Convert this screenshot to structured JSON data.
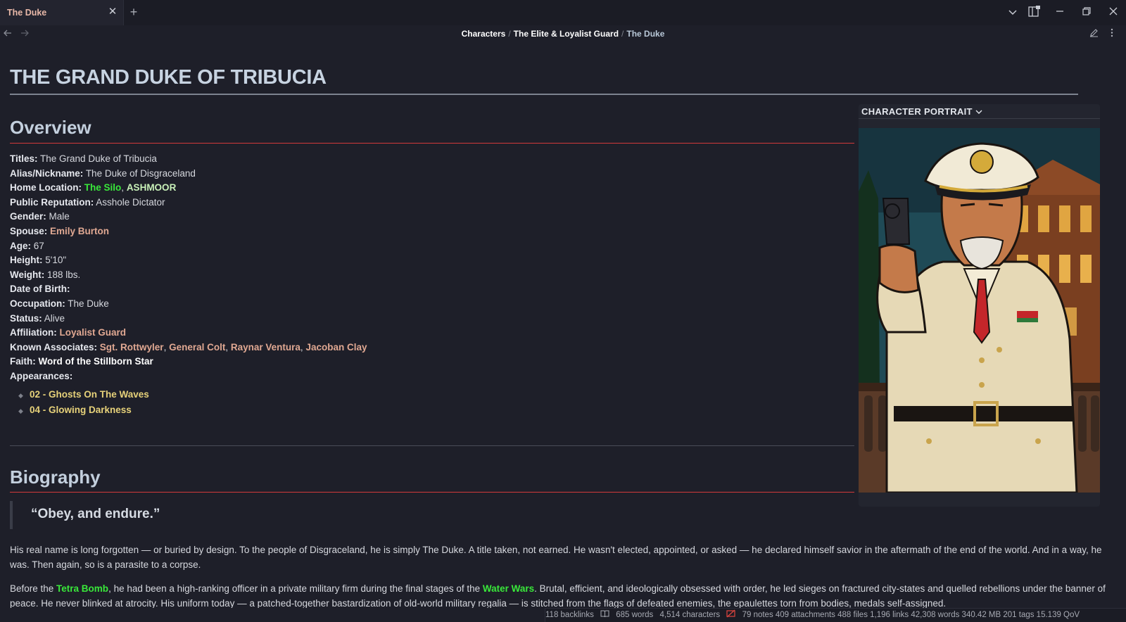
{
  "tab": {
    "title": "The Duke",
    "close_icon": "close-icon",
    "new_icon": "plus-icon"
  },
  "breadcrumb": {
    "items": [
      "Characters",
      "The Elite & Loyalist Guard"
    ],
    "current": "The Duke"
  },
  "page": {
    "title": "THE GRAND DUKE OF TRIBUCIA"
  },
  "overview": {
    "heading": "Overview",
    "fields": [
      {
        "key": "Titles:",
        "value": "The Grand Duke of Tribucia"
      },
      {
        "key": "Alias/Nickname:",
        "value": "The Duke of Disgraceland"
      },
      {
        "key": "Home Location:",
        "link1": "The Silo",
        "sep": ", ",
        "link2": "ASHMOOR"
      },
      {
        "key": "Public Reputation:",
        "value": "Asshole Dictator"
      },
      {
        "key": "Gender:",
        "value": "Male"
      },
      {
        "key": "Spouse:",
        "link": "Emily Burton"
      },
      {
        "key": "Age:",
        "value": "67"
      },
      {
        "key": "Height:",
        "value": "5'10\""
      },
      {
        "key": "Weight:",
        "value": "188 lbs."
      },
      {
        "key": "Date of Birth:",
        "value": ""
      },
      {
        "key": "Occupation:",
        "value": "The Duke"
      },
      {
        "key": "Status:",
        "value": "Alive"
      },
      {
        "key": "Affiliation:",
        "link": "Loyalist Guard"
      },
      {
        "key": "Known Associates:",
        "links": [
          "Sgt. Rottwyler",
          "General Colt",
          "Raynar Ventura",
          "Jacoban Clay"
        ]
      },
      {
        "key": "Faith:",
        "link": "Word of the Stillborn Star"
      },
      {
        "key": "Appearances:",
        "value": ""
      }
    ],
    "appearances": [
      "02 - Ghosts On The Waves",
      "04 - Glowing Darkness"
    ]
  },
  "biography": {
    "heading": "Biography",
    "quote": "“Obey, and endure.”",
    "para1": "His real name is long forgotten — or buried by design. To the people of Disgraceland, he is simply The Duke. A title taken, not earned. He wasn't elected, appointed, or asked — he declared himself savior in the aftermath of the end of the world. And in a way, he was. Then again, so is a parasite to a corpse.",
    "para2_a": "Before the ",
    "para2_link1": "Tetra Bomb",
    "para2_b": ", he had been a high-ranking officer in a private military firm during the final stages of the ",
    "para2_link2": "Water Wars",
    "para2_c": ". Brutal, efficient, and ideologically obsessed with order, he led sieges on fractured city-states and quelled rebellions under the banner of peace. He never blinked at atrocity. His uniform today — a patched-together bastardization of old-world military regalia — is stitched from the flags of defeated enemies, the epaulettes torn from bodies, medals self-assigned."
  },
  "portrait": {
    "heading": "CHARACTER PORTRAIT"
  },
  "status": {
    "backlinks": "118 backlinks",
    "words": "685 words",
    "characters": "4,514 characters",
    "vault": "79 notes 409 attachments 488 files 1,196 links 42,308 words 340.42 MB 201 tags 15.139 QoV"
  },
  "colors": {
    "accent_red": "#d33a3a",
    "link_green": "#39e83a",
    "link_rose": "#e0a892",
    "episode_gold": "#e7d27a"
  }
}
